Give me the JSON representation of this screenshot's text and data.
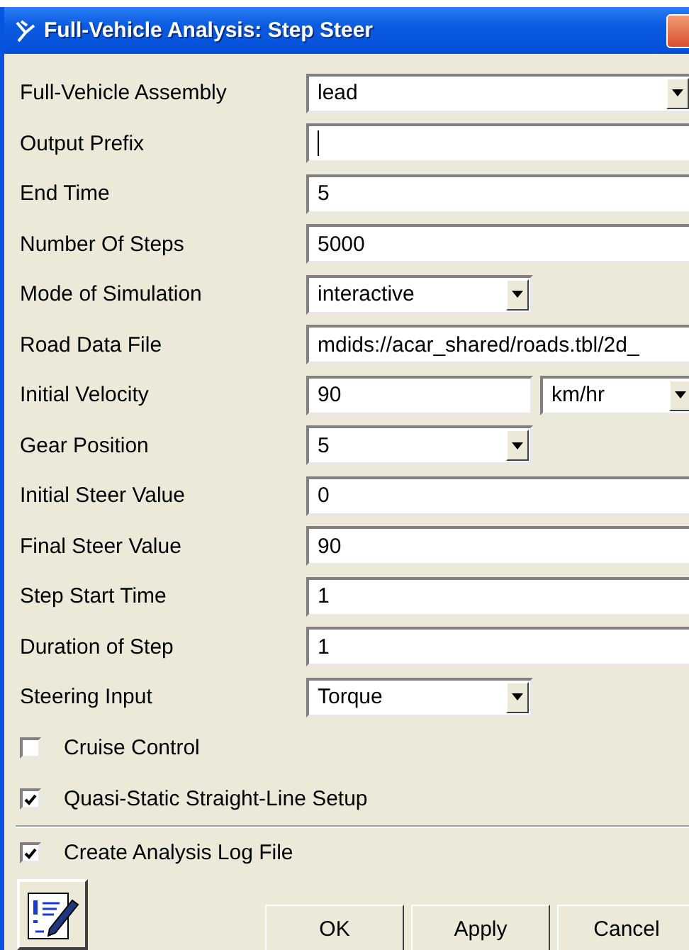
{
  "window": {
    "title": "Full-Vehicle Analysis: Step Steer"
  },
  "fields": [
    {
      "kind": "combo",
      "label": "Full-Vehicle Assembly",
      "value": "lead"
    },
    {
      "kind": "text",
      "label": "Output Prefix",
      "focused": true
    },
    {
      "kind": "text",
      "label": "End Time",
      "value": "5"
    },
    {
      "kind": "text",
      "label": "Number Of Steps",
      "value": "5000"
    },
    {
      "kind": "select",
      "label": "Mode of Simulation",
      "value": "interactive"
    },
    {
      "kind": "text",
      "label": "Road Data File",
      "value": "mdids://acar_shared/roads.tbl/2d_"
    },
    {
      "kind": "unit",
      "label": "Initial Velocity",
      "value": "90",
      "unit": "km/hr"
    },
    {
      "kind": "select",
      "label": "Gear Position",
      "value": "5"
    },
    {
      "kind": "text",
      "label": "Initial Steer Value",
      "value": "0"
    },
    {
      "kind": "text",
      "label": "Final Steer Value",
      "value": "90"
    },
    {
      "kind": "text",
      "label": "Step Start Time",
      "value": "1"
    },
    {
      "kind": "text",
      "label": "Duration of Step",
      "value": "1"
    },
    {
      "kind": "select",
      "label": "Steering Input",
      "value": "Torque"
    }
  ],
  "options": [
    {
      "label": "Cruise Control",
      "checked": false
    },
    {
      "label": "Quasi-Static Straight-Line Setup",
      "checked": true
    }
  ],
  "log_option": {
    "label": "Create Analysis Log File",
    "checked": true
  },
  "buttons": [
    "OK",
    "Apply",
    "Cancel"
  ]
}
